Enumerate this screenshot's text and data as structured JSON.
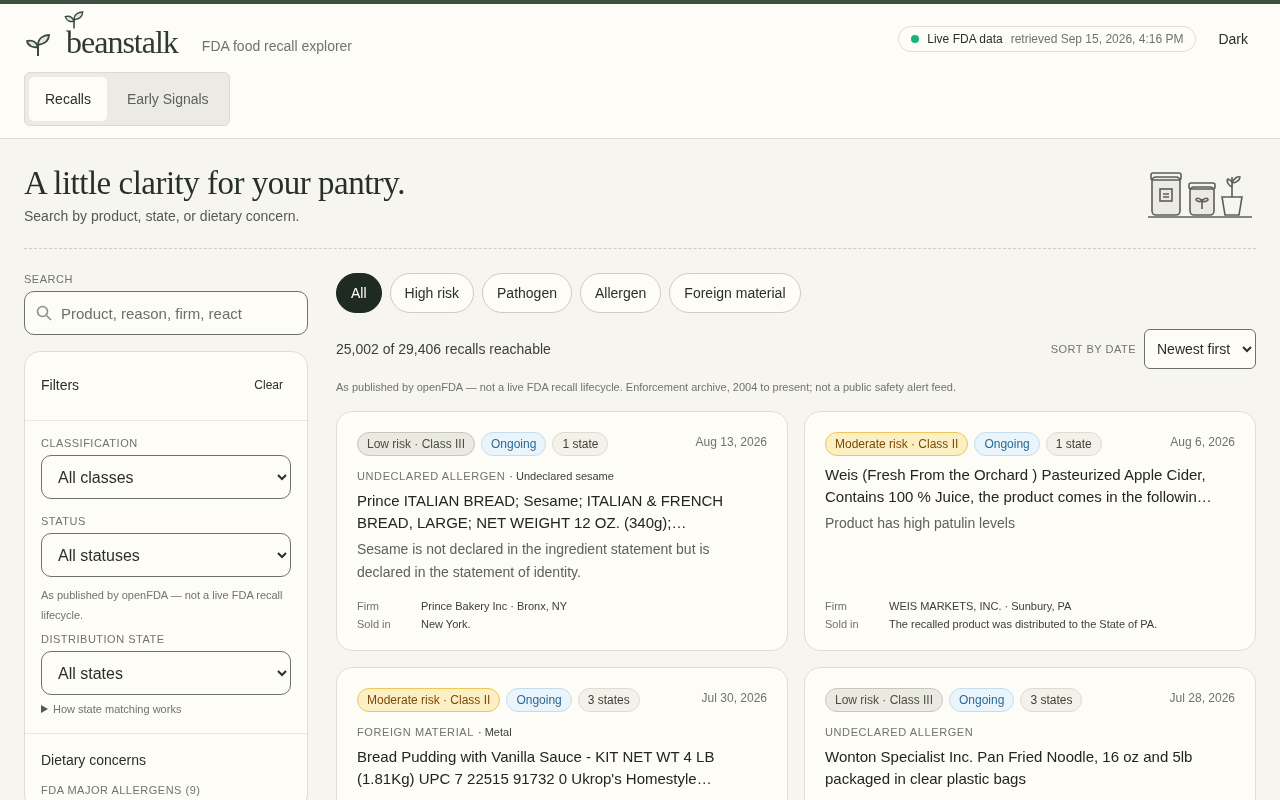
{
  "header": {
    "brand": "beanstalk",
    "tagline": "FDA food recall explorer",
    "live": {
      "on": true,
      "label": "Live FDA data",
      "retrieved": "retrieved Sep 15, 2026, 4:16 PM"
    },
    "theme_button": "Dark",
    "tabs": [
      {
        "label": "Recalls",
        "selected": true
      },
      {
        "label": "Early Signals",
        "selected": false
      }
    ]
  },
  "hero": {
    "title": "A little clarity for your pantry.",
    "subtitle": "Search by product, state, or dietary concern."
  },
  "sidebar": {
    "search_label": "SEARCH",
    "search": {
      "placeholder": "Product, reason, firm, react"
    },
    "filters": {
      "title": "Filters",
      "clear": "Clear",
      "selects": [
        {
          "label": "CLASSIFICATION",
          "value": "All classes"
        },
        {
          "label": "STATUS",
          "value": "All statuses",
          "note": "As published by openFDA — not a live FDA recall lifecycle."
        },
        {
          "label": "DISTRIBUTION STATE",
          "value": "All states"
        }
      ],
      "disclosure": {
        "label": "How state matching works",
        "expanded": false
      },
      "dietary_title": "Dietary concerns",
      "allergens_label": "FDA MAJOR ALLERGENS (9)"
    }
  },
  "chips": [
    {
      "label": "All",
      "selected": true
    },
    {
      "label": "High risk",
      "selected": false
    },
    {
      "label": "Pathogen",
      "selected": false
    },
    {
      "label": "Allergen",
      "selected": false
    },
    {
      "label": "Foreign material",
      "selected": false
    }
  ],
  "results": {
    "count": "25,002 of 29,406 recalls reachable",
    "sort_label": "SORT BY DATE",
    "sort_value": "Newest first",
    "note": "As published by openFDA — not a live FDA recall lifecycle. Enforcement archive, 2004 to present; not a public safety alert feed."
  },
  "recalls": [
    {
      "kind": "low",
      "risk_label": "Low risk · Class III",
      "status": "Ongoing",
      "states": "1 state",
      "date": "Aug 13, 2026",
      "category": "UNDECLARED ALLERGEN",
      "detail": "· Undeclared sesame",
      "title": "Prince ITALIAN BREAD; Sesame; ITALIAN & FRENCH BREAD, LARGE; NET WEIGHT 12 OZ. (340g);…",
      "reason": "Sesame is not declared in the ingredient statement but is declared in the statement of identity.",
      "firm_label": "Firm",
      "firm": "Prince Bakery Inc · Bronx, NY",
      "sold_label": "Sold in",
      "sold": "New York."
    },
    {
      "kind": "moderate",
      "risk_label": "Moderate risk · Class II",
      "status": "Ongoing",
      "states": "1 state",
      "date": "Aug 6, 2026",
      "title": "Weis (Fresh From the Orchard ) Pasteurized Apple Cider, Contains 100 % Juice, the product comes in the followin…",
      "reason": "Product has high patulin levels",
      "firm_label": "Firm",
      "firm": "WEIS MARKETS, INC. · Sunbury, PA",
      "sold_label": "Sold in",
      "sold": "The recalled product was distributed to the State of PA."
    },
    {
      "kind": "moderate",
      "risk_label": "Moderate risk · Class II",
      "status": "Ongoing",
      "states": "3 states",
      "date": "Jul 30, 2026",
      "category": "FOREIGN MATERIAL",
      "detail": "· Metal",
      "title": "Bread Pudding with Vanilla Sauce - KIT NET WT 4 LB (1.81Kg) UPC 7 22515 91732 0 Ukrop's Homestyle…"
    },
    {
      "kind": "low",
      "risk_label": "Low risk · Class III",
      "status": "Ongoing",
      "states": "3 states",
      "date": "Jul 28, 2026",
      "category": "UNDECLARED ALLERGEN",
      "title": "Wonton Specialist Inc. Pan Fried Noodle, 16 oz and 5lb packaged in clear plastic bags"
    }
  ]
}
